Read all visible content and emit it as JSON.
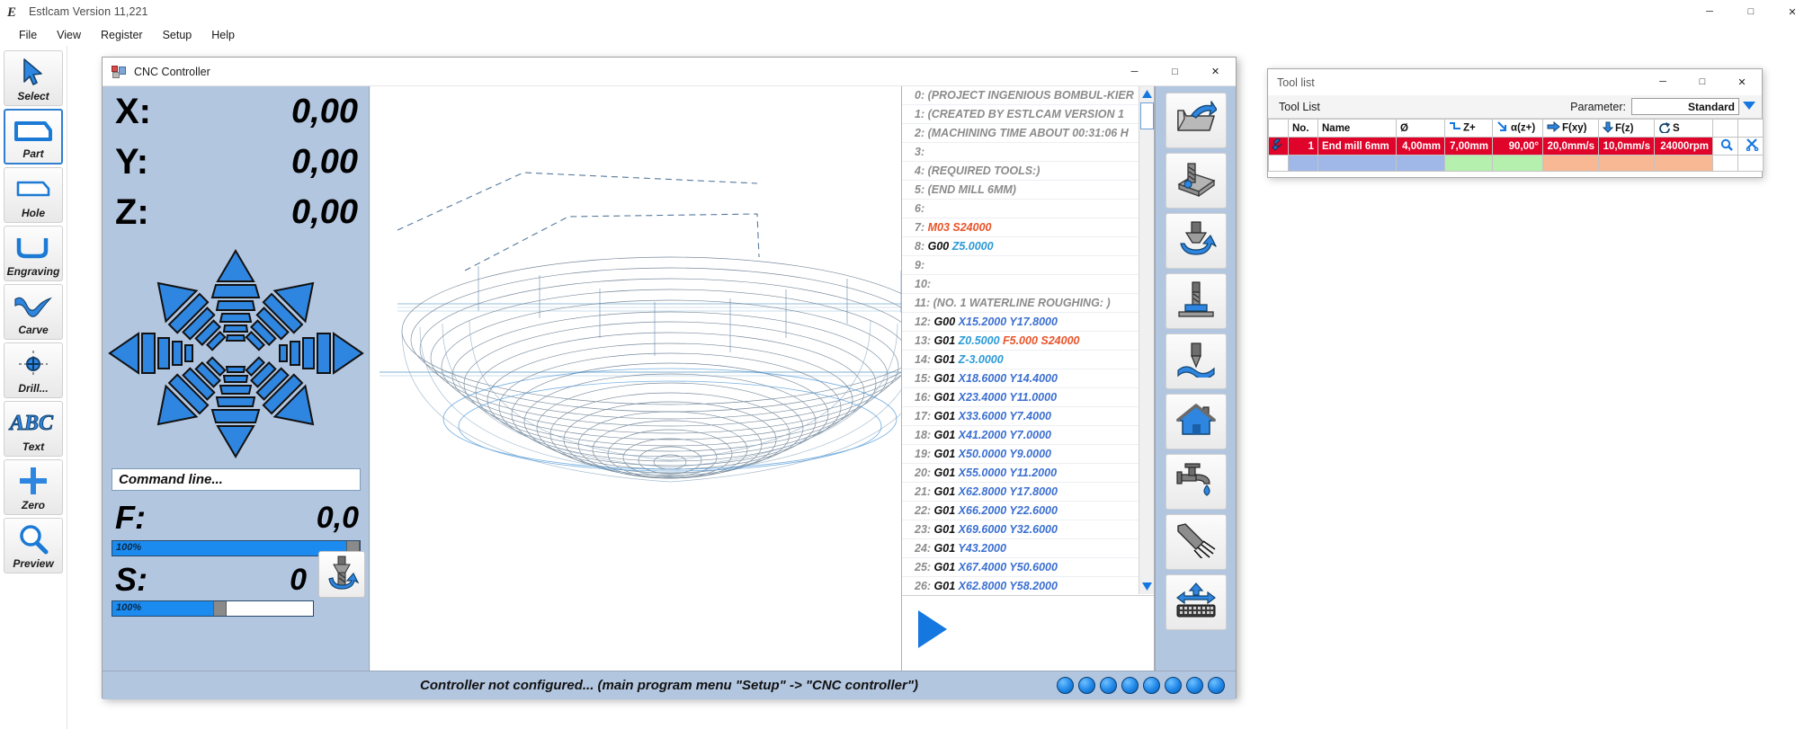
{
  "app": {
    "title": "Estlcam Version 11,221",
    "icon": "estlcam-logo-icon",
    "window_buttons": {
      "minimize": "─",
      "maximize": "□",
      "close": "✕"
    },
    "menu": [
      "File",
      "View",
      "Register",
      "Setup",
      "Help"
    ]
  },
  "left_rail": [
    {
      "label": "Select",
      "icon": "cursor-arrow-icon",
      "selected": false
    },
    {
      "label": "Part",
      "icon": "part-outline-icon",
      "selected": true
    },
    {
      "label": "Hole",
      "icon": "hole-outline-icon",
      "selected": false
    },
    {
      "label": "Engraving",
      "icon": "engraving-path-icon",
      "selected": false
    },
    {
      "label": "Carve",
      "icon": "carve-wave-icon",
      "selected": false
    },
    {
      "label": "Drill...",
      "icon": "drill-target-icon",
      "selected": false
    },
    {
      "label": "Text",
      "icon": "abc-text-icon",
      "selected": false
    },
    {
      "label": "Zero",
      "icon": "plus-crosshair-icon",
      "selected": false
    },
    {
      "label": "Preview",
      "icon": "magnifier-icon",
      "selected": false
    }
  ],
  "cnc_window": {
    "title": "CNC Controller",
    "icon": "cnc-controller-icon",
    "window_buttons": {
      "minimize": "─",
      "maximize": "□",
      "close": "✕"
    },
    "dro": [
      {
        "axis": "X:",
        "value": "0,00"
      },
      {
        "axis": "Y:",
        "value": "0,00"
      },
      {
        "axis": "Z:",
        "value": "0,00"
      }
    ],
    "command_line": {
      "placeholder": "Command line...",
      "value": "Command line..."
    },
    "feed": {
      "label": "F:",
      "value": "0,0",
      "override_percent": "100%",
      "override_fill_ratio": 0.945
    },
    "spindle": {
      "label": "S:",
      "value": "0",
      "override_percent": "100%",
      "override_fill_ratio": 0.5,
      "button_icon": "spindle-rotate-icon"
    },
    "jogpad_icon": "jog-arrow-pad-icon",
    "status_text": "Controller not configured... (main program menu \"Setup\" -> \"CNC controller\")",
    "led_count": 8,
    "play_button_icon": "play-triangle-icon",
    "right_rail": [
      {
        "icon": "open-folder-icon",
        "name": "open-file-button"
      },
      {
        "icon": "surface-probe-icon",
        "name": "surface-probe-button"
      },
      {
        "icon": "tool-length-probe-icon",
        "name": "tool-length-probe-button"
      },
      {
        "icon": "tool-change-icon",
        "name": "tool-change-button"
      },
      {
        "icon": "engrave-tip-icon",
        "name": "engrave-tip-button"
      },
      {
        "icon": "home-icon",
        "name": "home-button"
      },
      {
        "icon": "coolant-faucet-icon",
        "name": "coolant-button"
      },
      {
        "icon": "air-blast-icon",
        "name": "air-blast-button"
      },
      {
        "icon": "keyboard-jog-icon",
        "name": "keyboard-jog-button"
      }
    ],
    "gcode_lines": [
      {
        "n": "0:",
        "kind": "comment",
        "text": "(PROJECT INGENIOUS  BOMBUL-KIER"
      },
      {
        "n": "1:",
        "kind": "comment",
        "text": "(CREATED BY ESTLCAM  VERSION 1"
      },
      {
        "n": "2:",
        "kind": "comment",
        "text": "(MACHINING  TIME  ABOUT 00:31:06 H"
      },
      {
        "n": "3:",
        "kind": "empty",
        "text": ""
      },
      {
        "n": "4:",
        "kind": "comment",
        "text": "(REQUIRED TOOLS:)"
      },
      {
        "n": "5:",
        "kind": "comment",
        "text": "(END MILL  6MM)"
      },
      {
        "n": "6:",
        "kind": "empty",
        "text": ""
      },
      {
        "n": "7:",
        "kind": "mcode",
        "text": "M03 S24000"
      },
      {
        "n": "8:",
        "kind": "g00z",
        "cmd": "G00",
        "args": "Z5.0000"
      },
      {
        "n": "9:",
        "kind": "empty",
        "text": ""
      },
      {
        "n": "10:",
        "kind": "empty",
        "text": ""
      },
      {
        "n": "11:",
        "kind": "comment",
        "text": "(NO. 1 WATERLINE  ROUGHING: )"
      },
      {
        "n": "12:",
        "kind": "move",
        "cmd": "G00",
        "args": "X15.2000  Y17.8000"
      },
      {
        "n": "13:",
        "kind": "feedline",
        "cmd": "G01",
        "z": "Z0.5000",
        "f": "F5.000  S24000"
      },
      {
        "n": "14:",
        "kind": "zmove",
        "cmd": "G01",
        "args": "Z-3.0000"
      },
      {
        "n": "15:",
        "kind": "move",
        "cmd": "G01",
        "args": "X18.6000  Y14.4000"
      },
      {
        "n": "16:",
        "kind": "move",
        "cmd": "G01",
        "args": "X23.4000  Y11.0000"
      },
      {
        "n": "17:",
        "kind": "move",
        "cmd": "G01",
        "args": "X33.6000  Y7.4000"
      },
      {
        "n": "18:",
        "kind": "move",
        "cmd": "G01",
        "args": "X41.2000  Y7.0000"
      },
      {
        "n": "19:",
        "kind": "move",
        "cmd": "G01",
        "args": "X50.0000  Y9.0000"
      },
      {
        "n": "20:",
        "kind": "move",
        "cmd": "G01",
        "args": "X55.0000  Y11.2000"
      },
      {
        "n": "21:",
        "kind": "move",
        "cmd": "G01",
        "args": "X62.8000  Y17.8000"
      },
      {
        "n": "22:",
        "kind": "move",
        "cmd": "G01",
        "args": "X66.2000  Y22.6000"
      },
      {
        "n": "23:",
        "kind": "move",
        "cmd": "G01",
        "args": "X69.6000  Y32.6000"
      },
      {
        "n": "24:",
        "kind": "move",
        "cmd": "G01",
        "args": "Y43.2000"
      },
      {
        "n": "25:",
        "kind": "move",
        "cmd": "G01",
        "args": "X67.4000  Y50.6000"
      },
      {
        "n": "26:",
        "kind": "move",
        "cmd": "G01",
        "args": "X62.8000  Y58.2000"
      }
    ]
  },
  "tool_list_window": {
    "title": "Tool list",
    "window_buttons": {
      "minimize": "─",
      "maximize": "□",
      "close": "✕"
    },
    "toolbar": {
      "heading": "Tool List",
      "parameter_label": "Parameter:",
      "parameter_value": "Standard",
      "dropdown_icon": "chevron-down-icon"
    },
    "columns": [
      {
        "key": "wrench",
        "label": "",
        "icon": "wrench-icon"
      },
      {
        "key": "no",
        "label": "No.",
        "icon": ""
      },
      {
        "key": "name",
        "label": "Name",
        "icon": ""
      },
      {
        "key": "dia",
        "label": "Ø",
        "icon": ""
      },
      {
        "key": "zplus",
        "label": "Z+",
        "icon": "step-z-icon"
      },
      {
        "key": "alpha",
        "label": "α(z+)",
        "icon": "plunge-angle-icon"
      },
      {
        "key": "fxy",
        "label": "F(xy)",
        "icon": "arrow-right-icon"
      },
      {
        "key": "fz",
        "label": "F(z)",
        "icon": "arrow-down-icon"
      },
      {
        "key": "s",
        "label": "S",
        "icon": "rotate-icon"
      },
      {
        "key": "search",
        "label": "",
        "icon": "magnifier-icon"
      },
      {
        "key": "delete",
        "label": "",
        "icon": "scissors-icon"
      }
    ],
    "rows": [
      {
        "wrench_icon": "wrench-icon",
        "no": "1",
        "name": "End mill 6mm",
        "dia": "4,00mm",
        "zplus": "7,00mm",
        "alpha": "90,00°",
        "fxy": "20,0mm/s",
        "fz": "10,0mm/s",
        "s": "24000rpm",
        "search_icon": "magnifier-icon",
        "delete_icon": "scissors-icon",
        "selected": true
      }
    ],
    "swatch_row": [
      "",
      "blue",
      "blue",
      "blue",
      "green",
      "green",
      "peach",
      "peach",
      "peach",
      "white",
      "white"
    ]
  },
  "colors": {
    "selection_red": "#e0032a",
    "accent_blue": "#1577e0",
    "panel_blue": "#b3c6e0",
    "swatch_blue": "#9fb8e8",
    "swatch_green": "#b6f0ae",
    "swatch_peach": "#f9b894"
  }
}
